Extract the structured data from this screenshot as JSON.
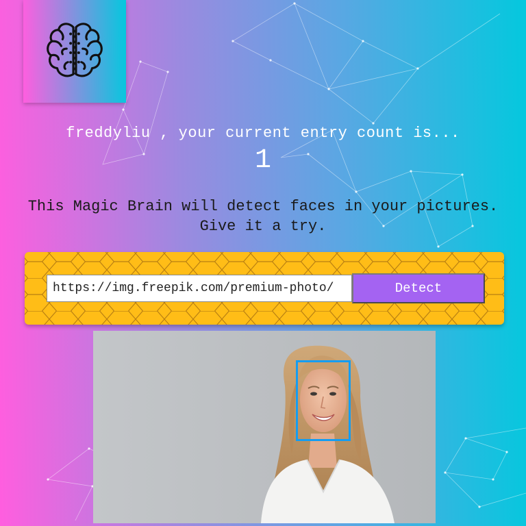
{
  "logo": {
    "icon": "brain-icon"
  },
  "user": {
    "entry_text": "freddyliu , your current entry count is...",
    "entry_count": "1"
  },
  "intro": {
    "line1": "This Magic Brain will detect faces in your pictures.",
    "line2": "Give it a try."
  },
  "form": {
    "url_value": "https://img.freepik.com/premium-photo/",
    "detect_label": "Detect"
  },
  "result": {
    "image_desc": "portrait-photo",
    "face_count": 1
  },
  "colors": {
    "gradient_start": "#ff5edf",
    "gradient_end": "#04c8de",
    "panel": "#ffbd17",
    "button": "#a463f2",
    "face_box": "#149df2"
  }
}
